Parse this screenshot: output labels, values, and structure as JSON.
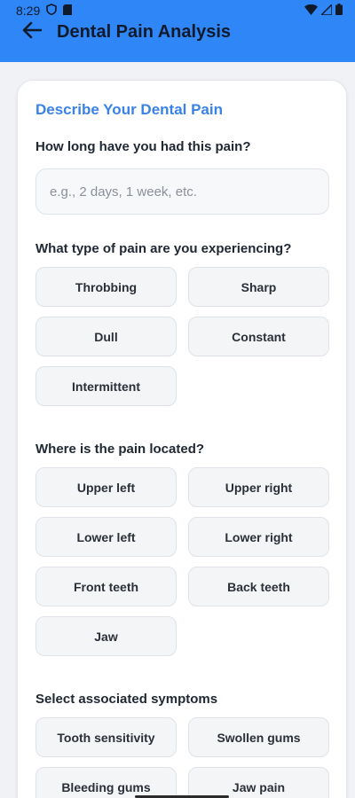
{
  "status_bar": {
    "time": "8:29",
    "icons": [
      "vpn-shield-icon",
      "sim-card-icon",
      "wifi-icon",
      "signal-icon",
      "battery-icon"
    ]
  },
  "header": {
    "title": "Dental Pain Analysis",
    "back_icon": "arrow-left-icon",
    "color": "#2f86f6"
  },
  "form": {
    "card_title": "Describe Your Dental Pain",
    "duration": {
      "label": "How long have you had this pain?",
      "value": "",
      "placeholder": "e.g., 2 days, 1 week, etc."
    },
    "pain_type": {
      "label": "What type of pain are you experiencing?",
      "options": [
        "Throbbing",
        "Sharp",
        "Dull",
        "Constant",
        "Intermittent"
      ]
    },
    "location": {
      "label": "Where is the pain located?",
      "options": [
        "Upper left",
        "Upper right",
        "Lower left",
        "Lower right",
        "Front teeth",
        "Back teeth",
        "Jaw"
      ]
    },
    "symptoms": {
      "label": "Select associated symptoms",
      "options": [
        "Tooth sensitivity",
        "Swollen gums",
        "Bleeding gums",
        "Jaw pain"
      ]
    }
  },
  "colors": {
    "accent": "#3a82e8",
    "chip_bg": "#f4f5f7",
    "page_bg": "#f1f2f5"
  }
}
